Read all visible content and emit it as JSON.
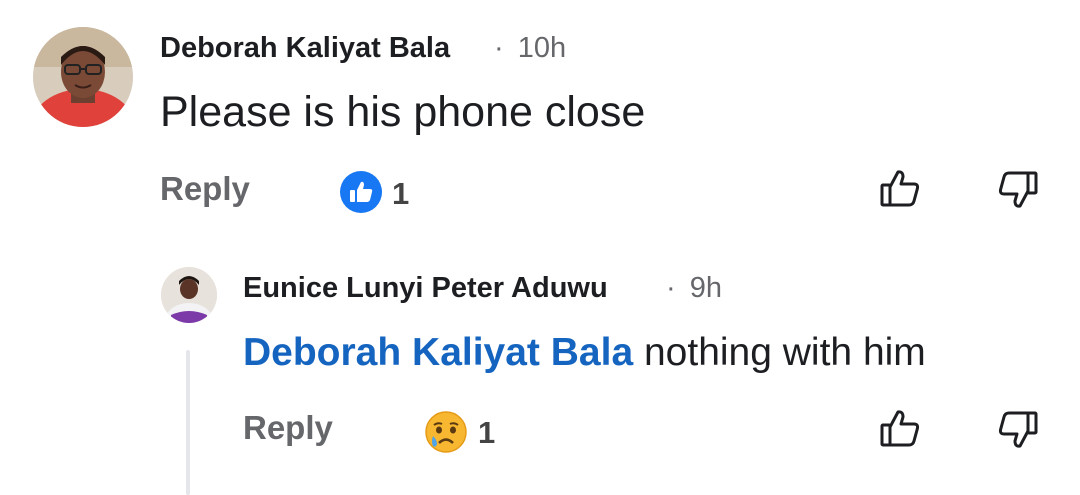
{
  "comment": {
    "author": "Deborah Kaliyat Bala",
    "separator": "·",
    "time": "10h",
    "text": "Please is his phone close",
    "reply_label": "Reply",
    "reaction_icon": "like-icon",
    "reaction_count": "1"
  },
  "reply": {
    "author": "Eunice Lunyi Peter Aduwu",
    "separator": "·",
    "time": "9h",
    "mention": "Deborah Kaliyat Bala",
    "text": " nothing with him",
    "reply_label": "Reply",
    "reaction_icon": "sad-emoji-icon",
    "reaction_count": "1"
  },
  "colors": {
    "like_blue": "#1877f2",
    "mention_blue": "#1565c0",
    "muted": "#65676b"
  }
}
